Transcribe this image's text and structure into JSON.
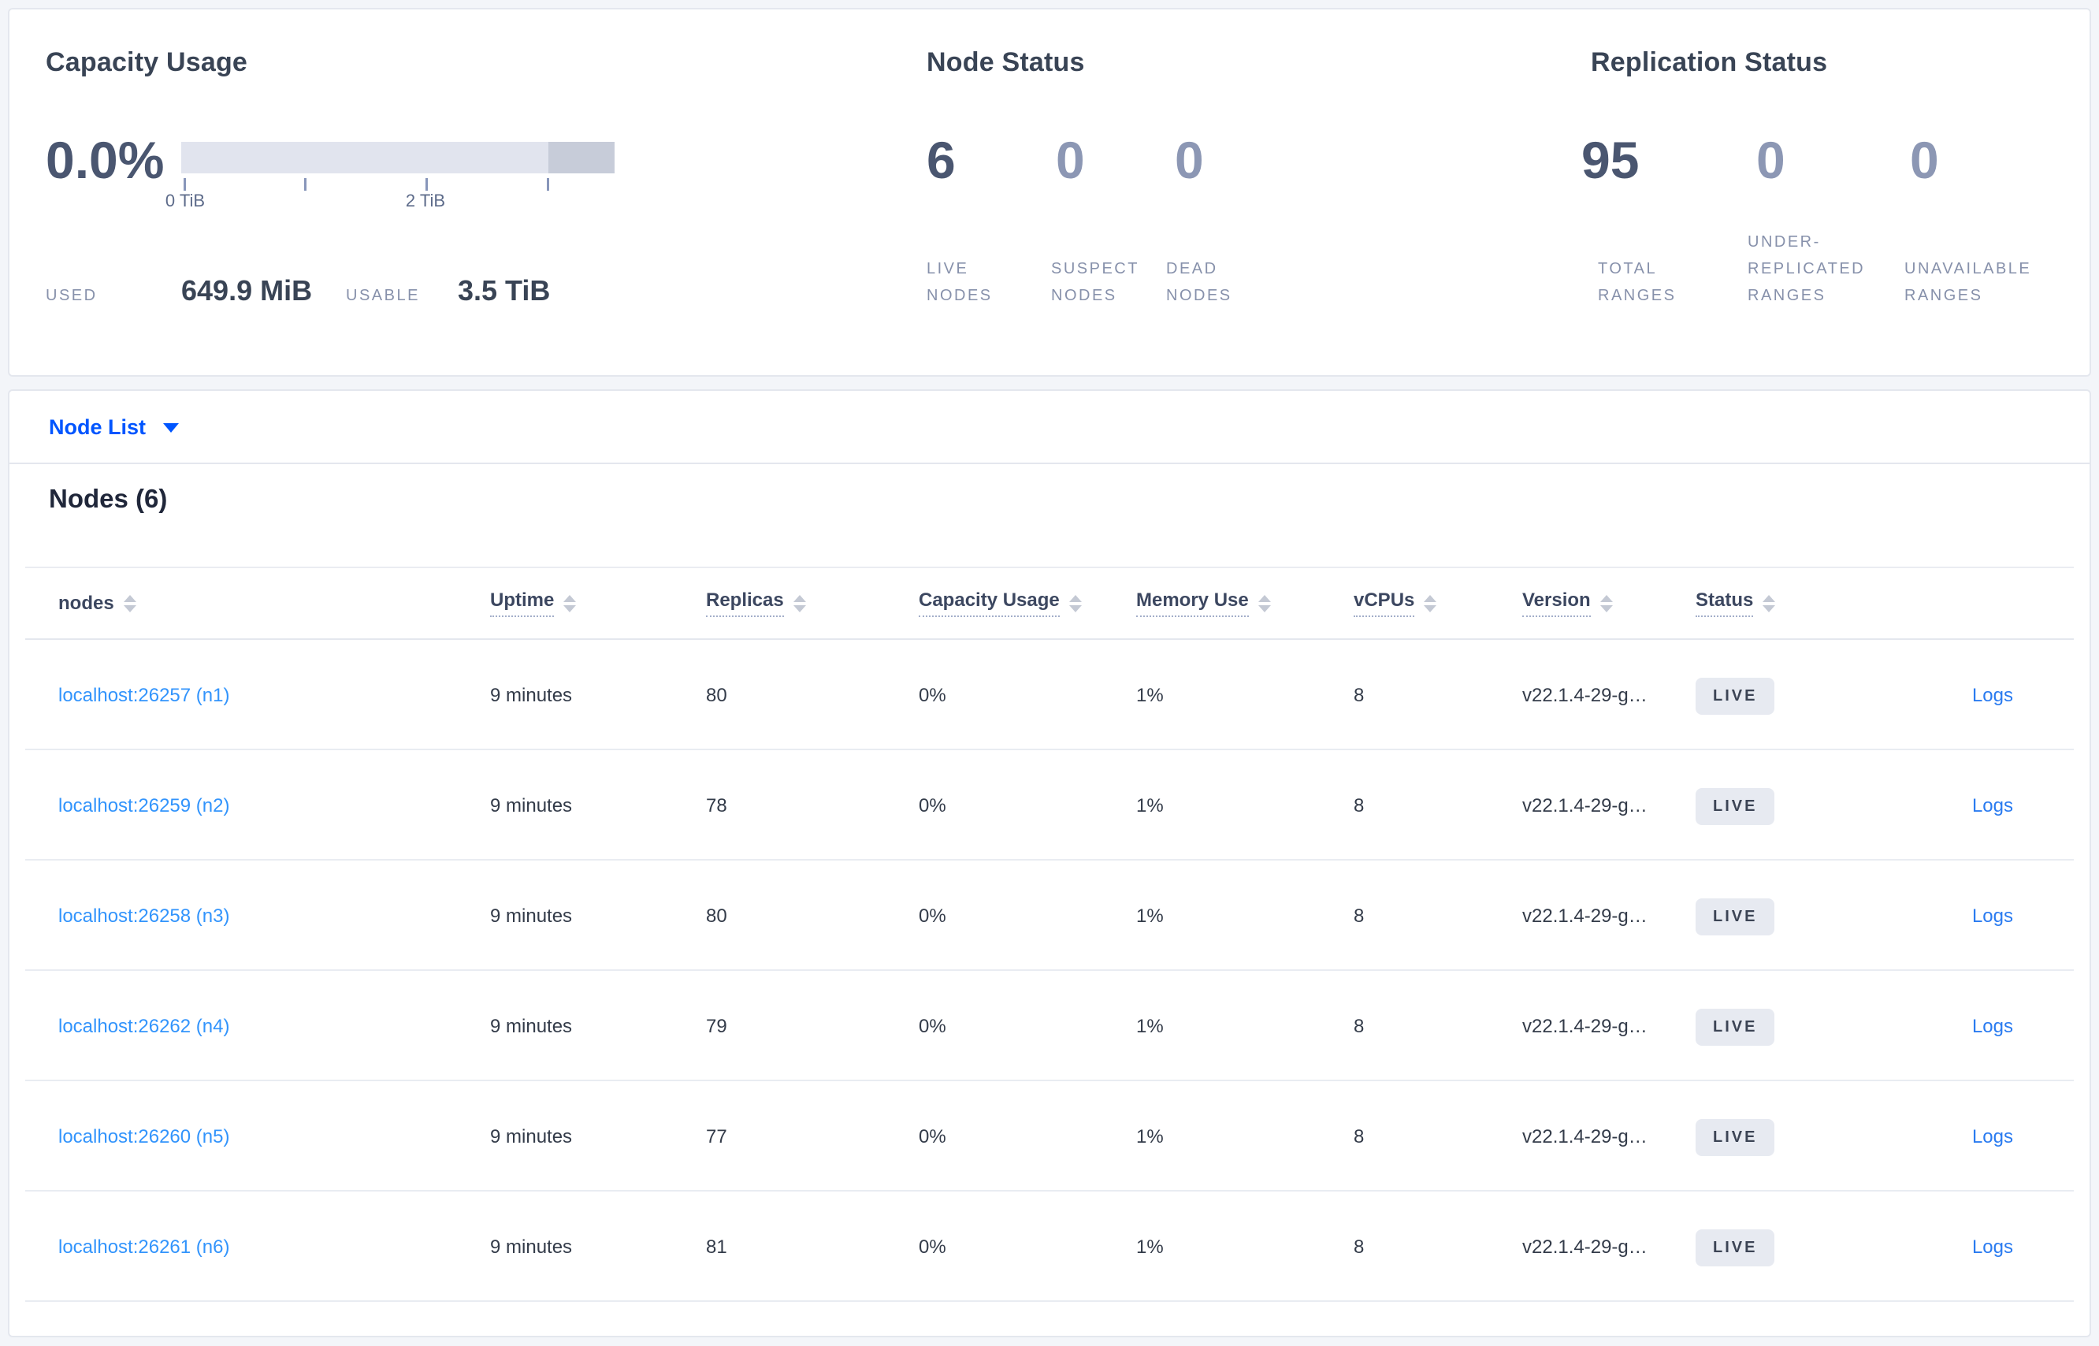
{
  "summary": {
    "capacity": {
      "title": "Capacity Usage",
      "percent": "0.0%",
      "tick_labels": [
        "0 TiB",
        "2 TiB"
      ],
      "used_label": "USED",
      "used_value": "649.9 MiB",
      "usable_label": "USABLE",
      "usable_value": "3.5 TiB"
    },
    "node_status": {
      "title": "Node Status",
      "stats": [
        {
          "value": "6",
          "label": "LIVE NODES"
        },
        {
          "value": "0",
          "label": "SUSPECT NODES"
        },
        {
          "value": "0",
          "label": "DEAD NODES"
        }
      ]
    },
    "replication": {
      "title": "Replication Status",
      "stats": [
        {
          "value": "95",
          "label": "TOTAL RANGES"
        },
        {
          "value": "0",
          "label": "UNDER-REPLICATED RANGES"
        },
        {
          "value": "0",
          "label": "UNAVAILABLE RANGES"
        }
      ]
    }
  },
  "view_selector": {
    "label": "Node List"
  },
  "table": {
    "title": "Nodes (6)",
    "columns": [
      {
        "label": "nodes"
      },
      {
        "label": "Uptime"
      },
      {
        "label": "Replicas"
      },
      {
        "label": "Capacity Usage"
      },
      {
        "label": "Memory Use"
      },
      {
        "label": "vCPUs"
      },
      {
        "label": "Version"
      },
      {
        "label": "Status"
      }
    ],
    "logs_label": "Logs",
    "rows": [
      {
        "node": "localhost:26257 (n1)",
        "uptime": "9 minutes",
        "replicas": "80",
        "capacity": "0%",
        "memory": "1%",
        "vcpus": "8",
        "version": "v22.1.4-29-g…",
        "status": "LIVE"
      },
      {
        "node": "localhost:26259 (n2)",
        "uptime": "9 minutes",
        "replicas": "78",
        "capacity": "0%",
        "memory": "1%",
        "vcpus": "8",
        "version": "v22.1.4-29-g…",
        "status": "LIVE"
      },
      {
        "node": "localhost:26258 (n3)",
        "uptime": "9 minutes",
        "replicas": "80",
        "capacity": "0%",
        "memory": "1%",
        "vcpus": "8",
        "version": "v22.1.4-29-g…",
        "status": "LIVE"
      },
      {
        "node": "localhost:26262 (n4)",
        "uptime": "9 minutes",
        "replicas": "79",
        "capacity": "0%",
        "memory": "1%",
        "vcpus": "8",
        "version": "v22.1.4-29-g…",
        "status": "LIVE"
      },
      {
        "node": "localhost:26260 (n5)",
        "uptime": "9 minutes",
        "replicas": "77",
        "capacity": "0%",
        "memory": "1%",
        "vcpus": "8",
        "version": "v22.1.4-29-g…",
        "status": "LIVE"
      },
      {
        "node": "localhost:26261 (n6)",
        "uptime": "9 minutes",
        "replicas": "81",
        "capacity": "0%",
        "memory": "1%",
        "vcpus": "8",
        "version": "v22.1.4-29-g…",
        "status": "LIVE"
      }
    ]
  },
  "colors": {
    "link_blue": "#0055ff",
    "node_link_blue": "#3294fc",
    "logs_link_blue": "#2a7bf0",
    "badge_bg": "#e7eaf1",
    "gauge_light": "#e1e4ee",
    "gauge_dark": "#c7ccd9",
    "text_dark": "#394455",
    "text_muted": "#8791ab"
  }
}
